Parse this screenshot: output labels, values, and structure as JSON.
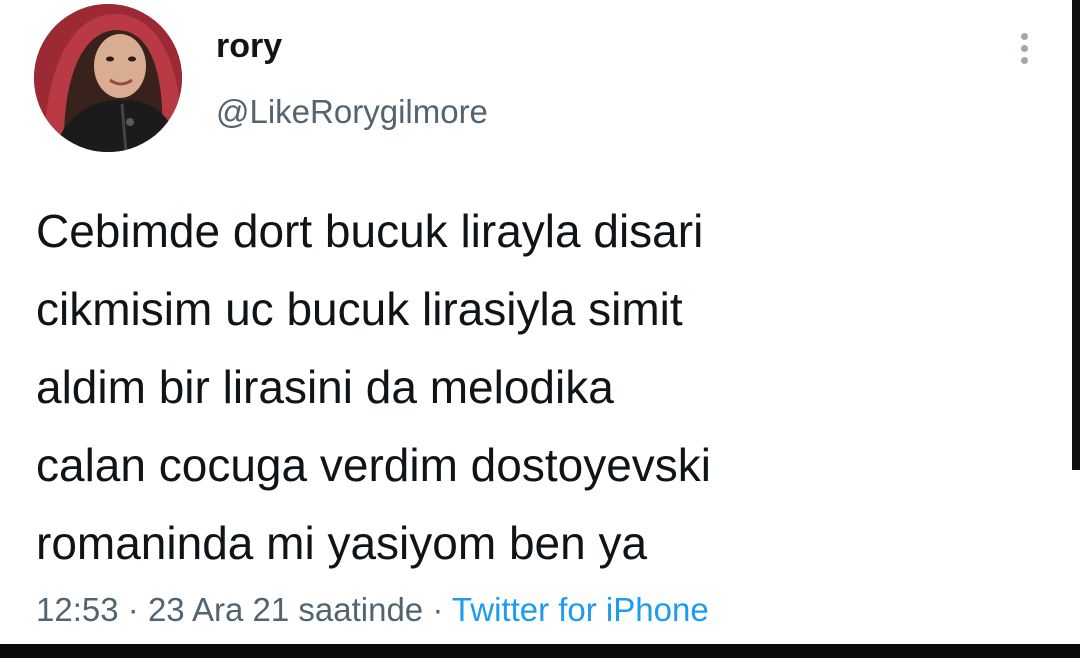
{
  "tweet": {
    "author": {
      "display_name": "rory",
      "handle": "@LikeRorygilmore",
      "avatar_icon": "profile-photo"
    },
    "text_lines": [
      "Cebimde dort bucuk lirayla disari",
      "cikmisim uc bucuk lirasiyla simit",
      "aldim bir lirasini da melodika",
      "calan cocuga verdim dostoyevski",
      "romaninda mi yasiyom ben ya"
    ],
    "time": "12:53",
    "separator": "·",
    "date": "23 Ara 21 saatinde",
    "source": "Twitter for iPhone",
    "more_icon": "more-vertical-icon"
  },
  "colors": {
    "text_primary": "#0f1419",
    "text_secondary": "#536471",
    "link": "#1d9bf0",
    "background": "#ffffff"
  }
}
